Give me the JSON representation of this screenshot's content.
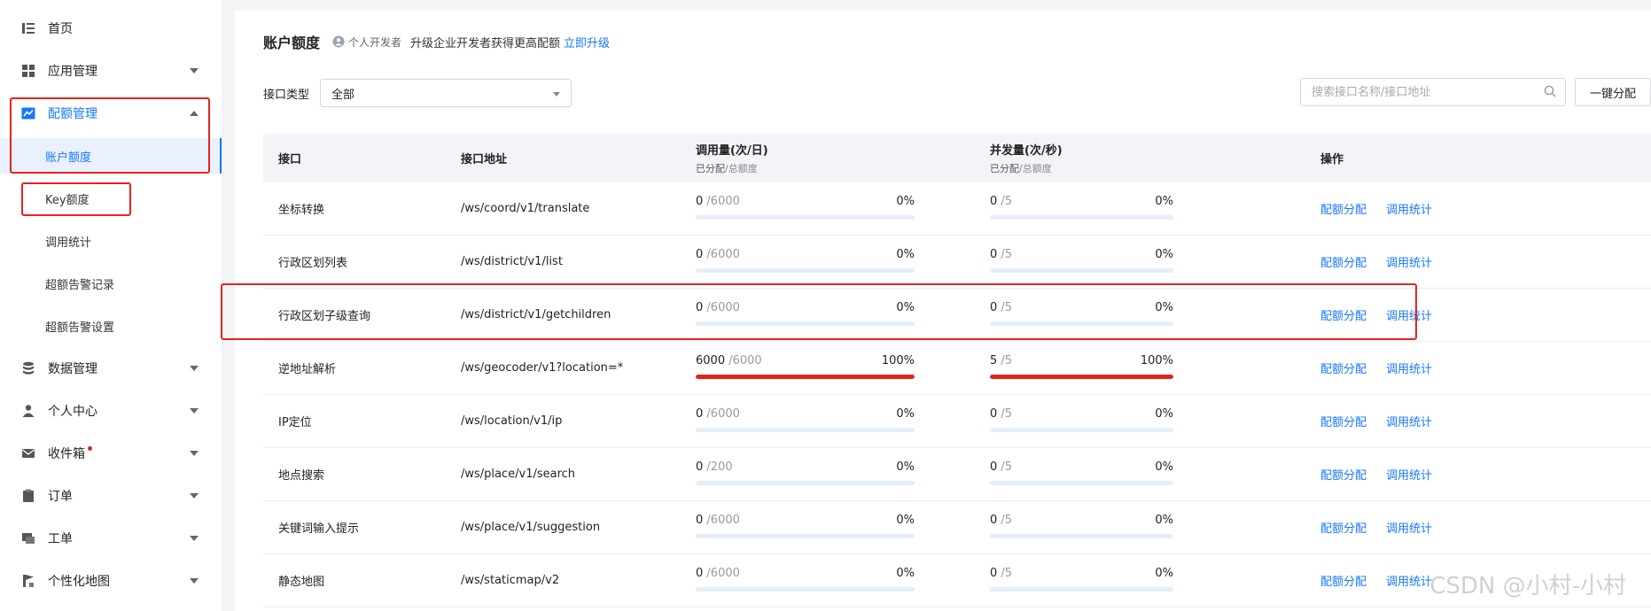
{
  "sidebar": {
    "items": [
      {
        "label": "首页",
        "icon": "home-icon",
        "has_chevron": false
      },
      {
        "label": "应用管理",
        "icon": "grid-icon",
        "has_chevron": true
      },
      {
        "label": "配额管理",
        "icon": "chart-icon",
        "has_chevron": true,
        "expanded": true,
        "active": true
      },
      {
        "label": "数据管理",
        "icon": "database-icon",
        "has_chevron": true
      },
      {
        "label": "个人中心",
        "icon": "user-icon",
        "has_chevron": true
      },
      {
        "label": "收件箱",
        "icon": "mail-icon",
        "has_chevron": true,
        "badge_dot": true
      },
      {
        "label": "订单",
        "icon": "clipboard-icon",
        "has_chevron": true
      },
      {
        "label": "工单",
        "icon": "ticket-icon",
        "has_chevron": true
      },
      {
        "label": "个性化地图",
        "icon": "map-icon",
        "has_chevron": true
      }
    ],
    "quota_sub_items": [
      {
        "label": "账户额度",
        "selected": true
      },
      {
        "label": "Key额度",
        "selected": false
      },
      {
        "label": "调用统计",
        "selected": false
      },
      {
        "label": "超额告警记录",
        "selected": false
      },
      {
        "label": "超额告警设置",
        "selected": false
      }
    ]
  },
  "header": {
    "title": "账户额度",
    "developer_tag": "个人开发者",
    "promo_text": "升级企业开发者获得更高配额",
    "upgrade_link": "立即升级"
  },
  "filters": {
    "type_label": "接口类型",
    "type_value": "全部",
    "search_placeholder": "搜索接口名称/接口地址",
    "batch_button": "一键分配"
  },
  "table": {
    "headers": {
      "api": "接口",
      "path": "接口地址",
      "daily": "调用量(次/日)",
      "concurrency": "并发量(次/秒)",
      "sub_allocated": "已分配",
      "sub_total": "/总额度",
      "actions": "操作"
    },
    "rows": [
      {
        "name": "坐标转换",
        "path": "/ws/coord/v1/translate",
        "daily_used": "0",
        "daily_total": "/6000",
        "daily_pct": "0%",
        "daily_frac": 0,
        "conc_used": "0",
        "conc_total": "/5",
        "conc_pct": "0%",
        "conc_frac": 0
      },
      {
        "name": "行政区划列表",
        "path": "/ws/district/v1/list",
        "daily_used": "0",
        "daily_total": "/6000",
        "daily_pct": "0%",
        "daily_frac": 0,
        "conc_used": "0",
        "conc_total": "/5",
        "conc_pct": "0%",
        "conc_frac": 0
      },
      {
        "name": "行政区划子级查询",
        "path": "/ws/district/v1/getchildren",
        "daily_used": "0",
        "daily_total": "/6000",
        "daily_pct": "0%",
        "daily_frac": 0,
        "conc_used": "0",
        "conc_total": "/5",
        "conc_pct": "0%",
        "conc_frac": 0
      },
      {
        "name": "逆地址解析",
        "path": "/ws/geocoder/v1?location=*",
        "daily_used": "6000",
        "daily_total": "/6000",
        "daily_pct": "100%",
        "daily_frac": 1,
        "conc_used": "5",
        "conc_total": "/5",
        "conc_pct": "100%",
        "conc_frac": 1
      },
      {
        "name": "IP定位",
        "path": "/ws/location/v1/ip",
        "daily_used": "0",
        "daily_total": "/6000",
        "daily_pct": "0%",
        "daily_frac": 0,
        "conc_used": "0",
        "conc_total": "/5",
        "conc_pct": "0%",
        "conc_frac": 0
      },
      {
        "name": "地点搜索",
        "path": "/ws/place/v1/search",
        "daily_used": "0",
        "daily_total": "/200",
        "daily_pct": "0%",
        "daily_frac": 0,
        "conc_used": "0",
        "conc_total": "/5",
        "conc_pct": "0%",
        "conc_frac": 0
      },
      {
        "name": "关键词输入提示",
        "path": "/ws/place/v1/suggestion",
        "daily_used": "0",
        "daily_total": "/6000",
        "daily_pct": "0%",
        "daily_frac": 0,
        "conc_used": "0",
        "conc_total": "/5",
        "conc_pct": "0%",
        "conc_frac": 0
      },
      {
        "name": "静态地图",
        "path": "/ws/staticmap/v2",
        "daily_used": "0",
        "daily_total": "/6000",
        "daily_pct": "0%",
        "daily_frac": 0,
        "conc_used": "0",
        "conc_total": "/5",
        "conc_pct": "0%",
        "conc_frac": 0
      }
    ],
    "action_allocate": "配额分配",
    "action_stats": "调用统计"
  },
  "watermark": "CSDN @小村-小村",
  "colors": {
    "accent": "#1677ff",
    "highlight": "#e5231e",
    "bar_bg": "#e6edf9"
  }
}
